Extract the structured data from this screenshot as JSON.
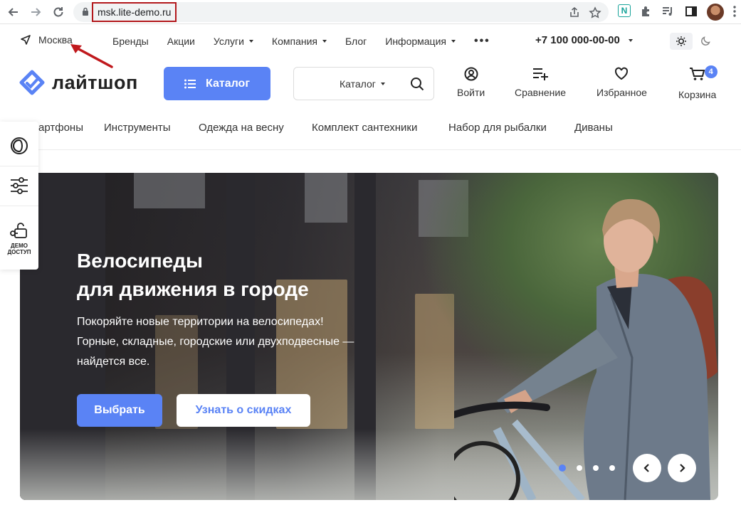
{
  "browser": {
    "url": "msk.lite-demo.ru",
    "extension_label": "N"
  },
  "topbar": {
    "city": "Москва",
    "nav": [
      {
        "label": "Бренды",
        "has_caret": false
      },
      {
        "label": "Акции",
        "has_caret": false
      },
      {
        "label": "Услуги",
        "has_caret": true
      },
      {
        "label": "Компания",
        "has_caret": true
      },
      {
        "label": "Блог",
        "has_caret": false
      },
      {
        "label": "Информация",
        "has_caret": true
      }
    ],
    "more": "•••",
    "phone": "+7 100 000-00-00"
  },
  "header": {
    "logo_text": "лайтшоп",
    "catalog_label": "Каталог",
    "search_category": "Каталог",
    "actions": {
      "login": "Войти",
      "compare": "Сравнение",
      "favorites": "Избранное",
      "cart": "Корзина",
      "cart_count": "4"
    }
  },
  "categories": [
    "артфоны",
    "Инструменты",
    "Одежда на весну",
    "Комплект сантехники",
    "Набор для рыбалки",
    "Диваны"
  ],
  "side_panel": {
    "demo_label_1": "ДЕМО",
    "demo_label_2": "ДОСТУП"
  },
  "banner": {
    "title_line1": "Велосипеды",
    "title_line2": "для движения в городе",
    "subtitle_line1": "Покоряйте новые территории на велосипедах!",
    "subtitle_line2": "Горные, складные, городские или двухподвесные —",
    "subtitle_line3": "найдется все.",
    "primary_button": "Выбрать",
    "secondary_button": "Узнать о скидках",
    "slides_count": 4,
    "active_slide": 1
  },
  "colors": {
    "accent": "#5a83f5",
    "url_highlight": "#b3181c",
    "annotation_arrow": "#c0191d"
  }
}
